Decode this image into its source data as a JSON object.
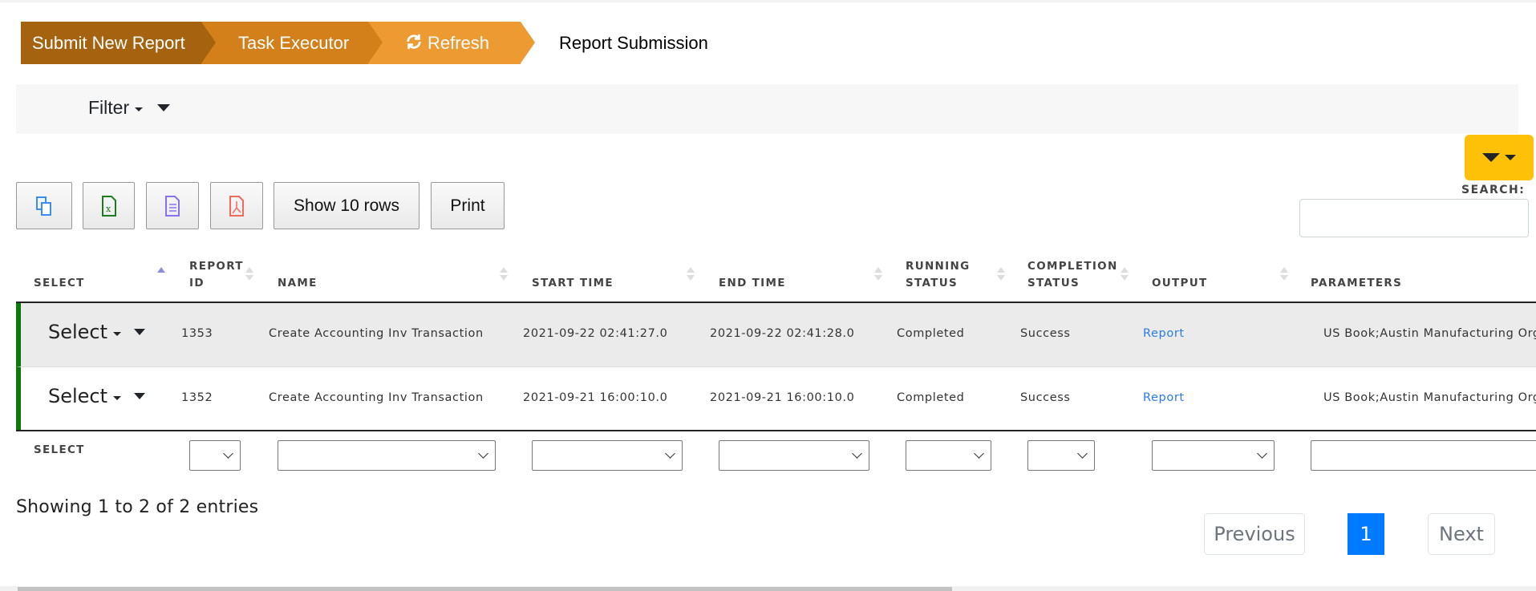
{
  "breadcrumb": {
    "items": [
      {
        "label": "Submit New Report",
        "color": "#a5620f"
      },
      {
        "label": "Task Executor",
        "color": "#d4801a"
      },
      {
        "label": "Refresh",
        "icon": "refresh-icon",
        "color": "#ee9a32"
      }
    ],
    "current": "Report Submission"
  },
  "filter": {
    "label": "Filter"
  },
  "column_toggle": {
    "color": "#ffc107"
  },
  "toolbar": {
    "copy_icon": "copy-icon",
    "excel_icon": "excel-icon",
    "csv_icon": "csv-icon",
    "pdf_icon": "pdf-icon",
    "show_rows_label": "Show 10 rows",
    "print_label": "Print"
  },
  "search": {
    "label": "SEARCH:",
    "value": "",
    "placeholder": ""
  },
  "table": {
    "columns": [
      {
        "key": "select",
        "label": "SELECT",
        "sort": "asc"
      },
      {
        "key": "report_id",
        "label_line1": "REPORT",
        "label_line2": "ID"
      },
      {
        "key": "name",
        "label": "NAME"
      },
      {
        "key": "start_time",
        "label": "START TIME"
      },
      {
        "key": "end_time",
        "label": "END TIME"
      },
      {
        "key": "running_status",
        "label_line1": "RUNNING",
        "label_line2": "STATUS"
      },
      {
        "key": "completion_status",
        "label_line1": "COMPLETION",
        "label_line2": "STATUS"
      },
      {
        "key": "output",
        "label": "OUTPUT"
      },
      {
        "key": "parameters",
        "label": "PARAMETERS"
      }
    ],
    "rows": [
      {
        "select": "Select",
        "report_id": "1353",
        "name": "Create Accounting Inv Transaction",
        "start_time": "2021-09-22 02:41:27.0",
        "end_time": "2021-09-22 02:41:28.0",
        "running_status": "Completed",
        "completion_status": "Success",
        "output": "Report",
        "parameters": "US Book;Austin Manufacturing Org;;n"
      },
      {
        "select": "Select",
        "report_id": "1352",
        "name": "Create Accounting Inv Transaction",
        "start_time": "2021-09-21 16:00:10.0",
        "end_time": "2021-09-21 16:00:10.0",
        "running_status": "Completed",
        "completion_status": "Success",
        "output": "Report",
        "parameters": "US Book;Austin Manufacturing Org;;n"
      }
    ],
    "row_accent_color": "#0b7a0b",
    "footer_label": "SELECT"
  },
  "info": "Showing 1 to 2 of 2 entries",
  "pagination": {
    "previous": "Previous",
    "current": "1",
    "next": "Next",
    "active_color": "#007bff"
  }
}
